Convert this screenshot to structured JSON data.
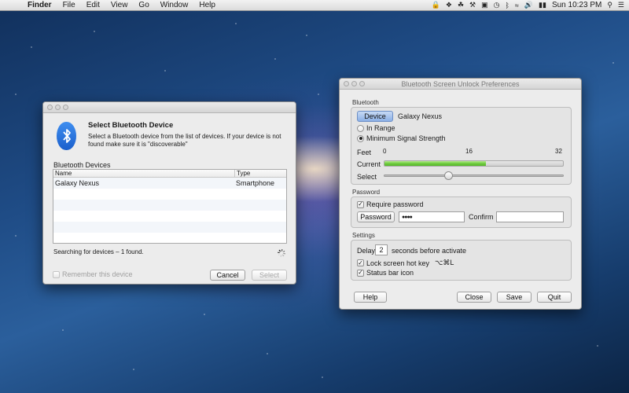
{
  "menubar": {
    "apple_icon": "apple-icon",
    "app_name": "Finder",
    "items": [
      "File",
      "Edit",
      "View",
      "Go",
      "Window",
      "Help"
    ],
    "clock": "Sun 10:23 PM"
  },
  "bt_dialog": {
    "title": "Select Bluetooth Device",
    "message": "Select a Bluetooth device from the list of devices. If your device is not found make sure it is \"discoverable\"",
    "list_title": "Bluetooth Devices",
    "columns": [
      "Name",
      "Type"
    ],
    "rows": [
      {
        "name": "Galaxy Nexus",
        "type": "Smartphone"
      }
    ],
    "status": "Searching for devices – 1 found.",
    "remember_label": "Remember this device",
    "remember_checked": false,
    "cancel_label": "Cancel",
    "select_label": "Select"
  },
  "prefs": {
    "title": "Bluetooth Screen Unlock Preferences",
    "bluetooth_section": "Bluetooth",
    "device_button": "Device",
    "device_name": "Galaxy Nexus",
    "radio_in_range": "In Range",
    "radio_min_signal": "Minimum Signal Strength",
    "radio_selected": "Minimum Signal Strength",
    "feet_label": "Feet",
    "scale_ticks": [
      "0",
      "16",
      "32"
    ],
    "current_label": "Current",
    "current_level": 0.57,
    "select_label": "Select",
    "select_level": 0.36,
    "password_section": "Password",
    "require_password_label": "Require password",
    "require_password_checked": true,
    "password_button": "Password",
    "password_value": "●●●●",
    "confirm_label": "Confirm",
    "confirm_value": "",
    "settings_section": "Settings",
    "delay_label": "Delay",
    "delay_value": "2",
    "delay_suffix": "seconds before activate",
    "lock_hotkey_label": "Lock screen hot key",
    "lock_hotkey_value": "⌥⌘L",
    "lock_hotkey_checked": true,
    "status_bar_label": "Status bar icon",
    "status_bar_checked": true,
    "help_button": "Help",
    "close_button": "Close",
    "save_button": "Save",
    "quit_button": "Quit"
  },
  "colors": {
    "meter_green": "#6ecb3e",
    "bluetooth_blue": "#1b5fcc"
  }
}
